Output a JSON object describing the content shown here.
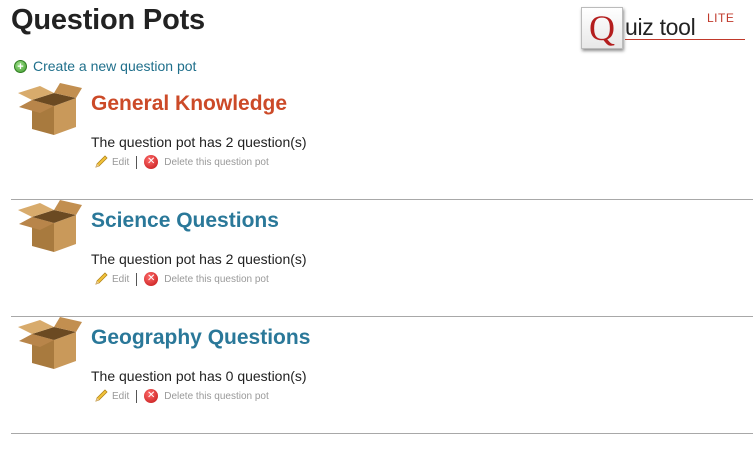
{
  "page": {
    "title": "Question Pots"
  },
  "logo": {
    "letter": "Q",
    "text": "uiz tool",
    "badge": "LITE"
  },
  "create_link": {
    "label": "Create a new question pot",
    "icon": "plus-circle-icon"
  },
  "pots": [
    {
      "title": "General Knowledge",
      "count_text": "The question pot has 2 question(s)",
      "active": true
    },
    {
      "title": "Science Questions",
      "count_text": "The question pot has 2 question(s)",
      "active": false
    },
    {
      "title": "Geography Questions",
      "count_text": "The question pot has 0 question(s)",
      "active": false
    }
  ],
  "actions": {
    "edit_label": "Edit",
    "delete_label": "Delete this question pot"
  },
  "colors": {
    "link": "#2a7899",
    "active_title": "#cc4a28",
    "logo_red": "#b41e1e"
  }
}
